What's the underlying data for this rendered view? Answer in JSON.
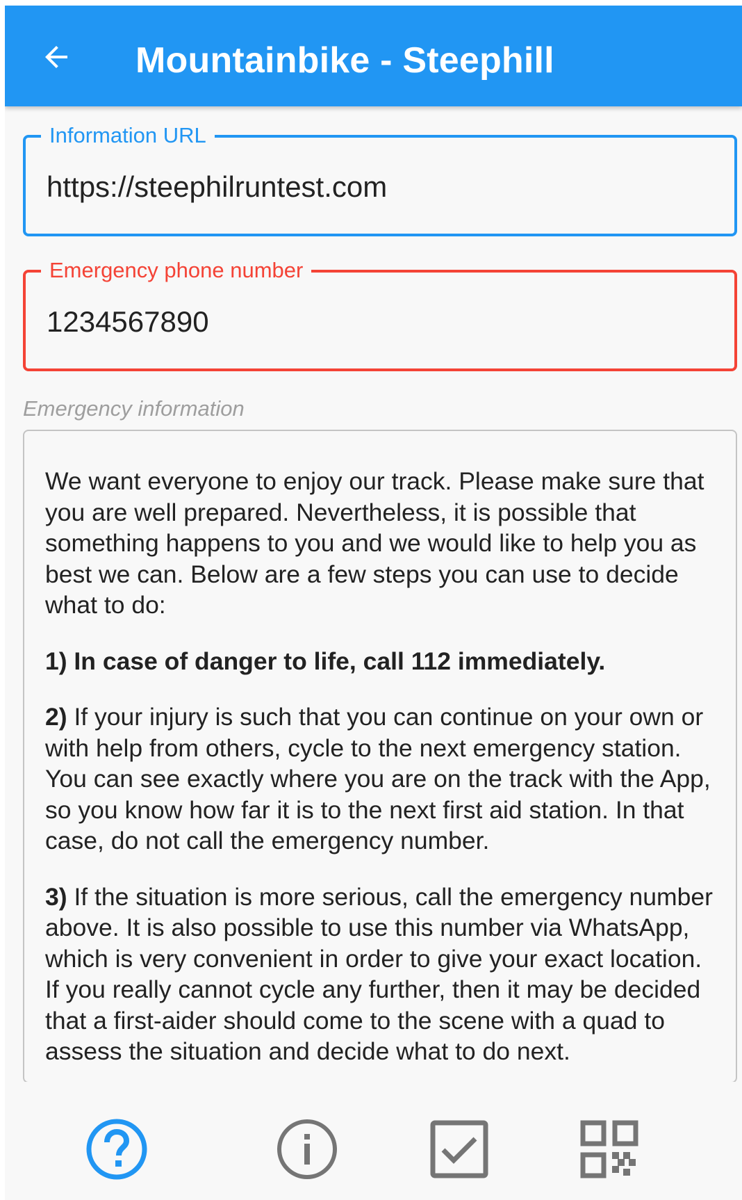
{
  "appbar": {
    "title": "Mountainbike - Steephill",
    "back_icon": "arrow-left-icon",
    "background_color": "#2196f3"
  },
  "form": {
    "url_field": {
      "label": "Information URL",
      "value": "https://steephilruntest.com",
      "color": "#2196f3"
    },
    "phone_field": {
      "label": "Emergency phone number",
      "value": "1234567890",
      "color": "#f44336"
    },
    "emergency_info": {
      "label": "Emergency information",
      "intro": "We want everyone to enjoy our track. Please make sure that you are well prepared. Nevertheless, it is possible that something happens to you and we would like to help you as best we can. Below are a few steps you can use to decide what to do:",
      "step1": "1) In case of danger to life, call 112 immediately.",
      "step2_num": "2)",
      "step2": " If your injury is such that you can continue on your own or with help from others, cycle to the next emergency station. You can see exactly where you are on the track with the App, so you know how far it is to the next first aid station. In that case, do not call the emergency number.",
      "step3_num": "3)",
      "step3": " If the situation is more serious, call the emergency number above. It is also possible to use this number via WhatsApp, which is very convenient in order to give your exact location. If you really cannot cycle any further, then it may be decided that a first-aider should come to the scene with a quad to assess the situation and decide what to do next."
    }
  },
  "bottom_nav": {
    "items": [
      {
        "icon": "help-circle-icon",
        "active": true
      },
      {
        "icon": "info-circle-icon",
        "active": false
      },
      {
        "icon": "checkbox-checked-icon",
        "active": false
      },
      {
        "icon": "qr-code-icon",
        "active": false
      }
    ],
    "active_color": "#2196f3",
    "inactive_color": "#757575"
  }
}
